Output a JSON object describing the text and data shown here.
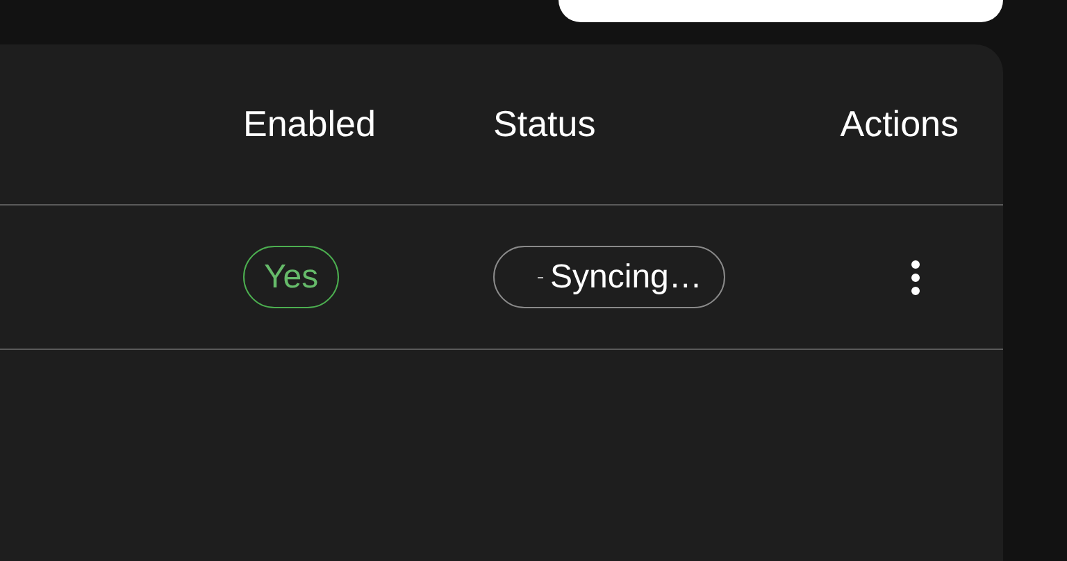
{
  "table": {
    "columns": [
      "Enabled",
      "Status",
      "Actions"
    ],
    "rows": [
      {
        "enabled": "Yes",
        "status": {
          "kind": "syncing",
          "label": "Syncing…"
        }
      }
    ]
  }
}
